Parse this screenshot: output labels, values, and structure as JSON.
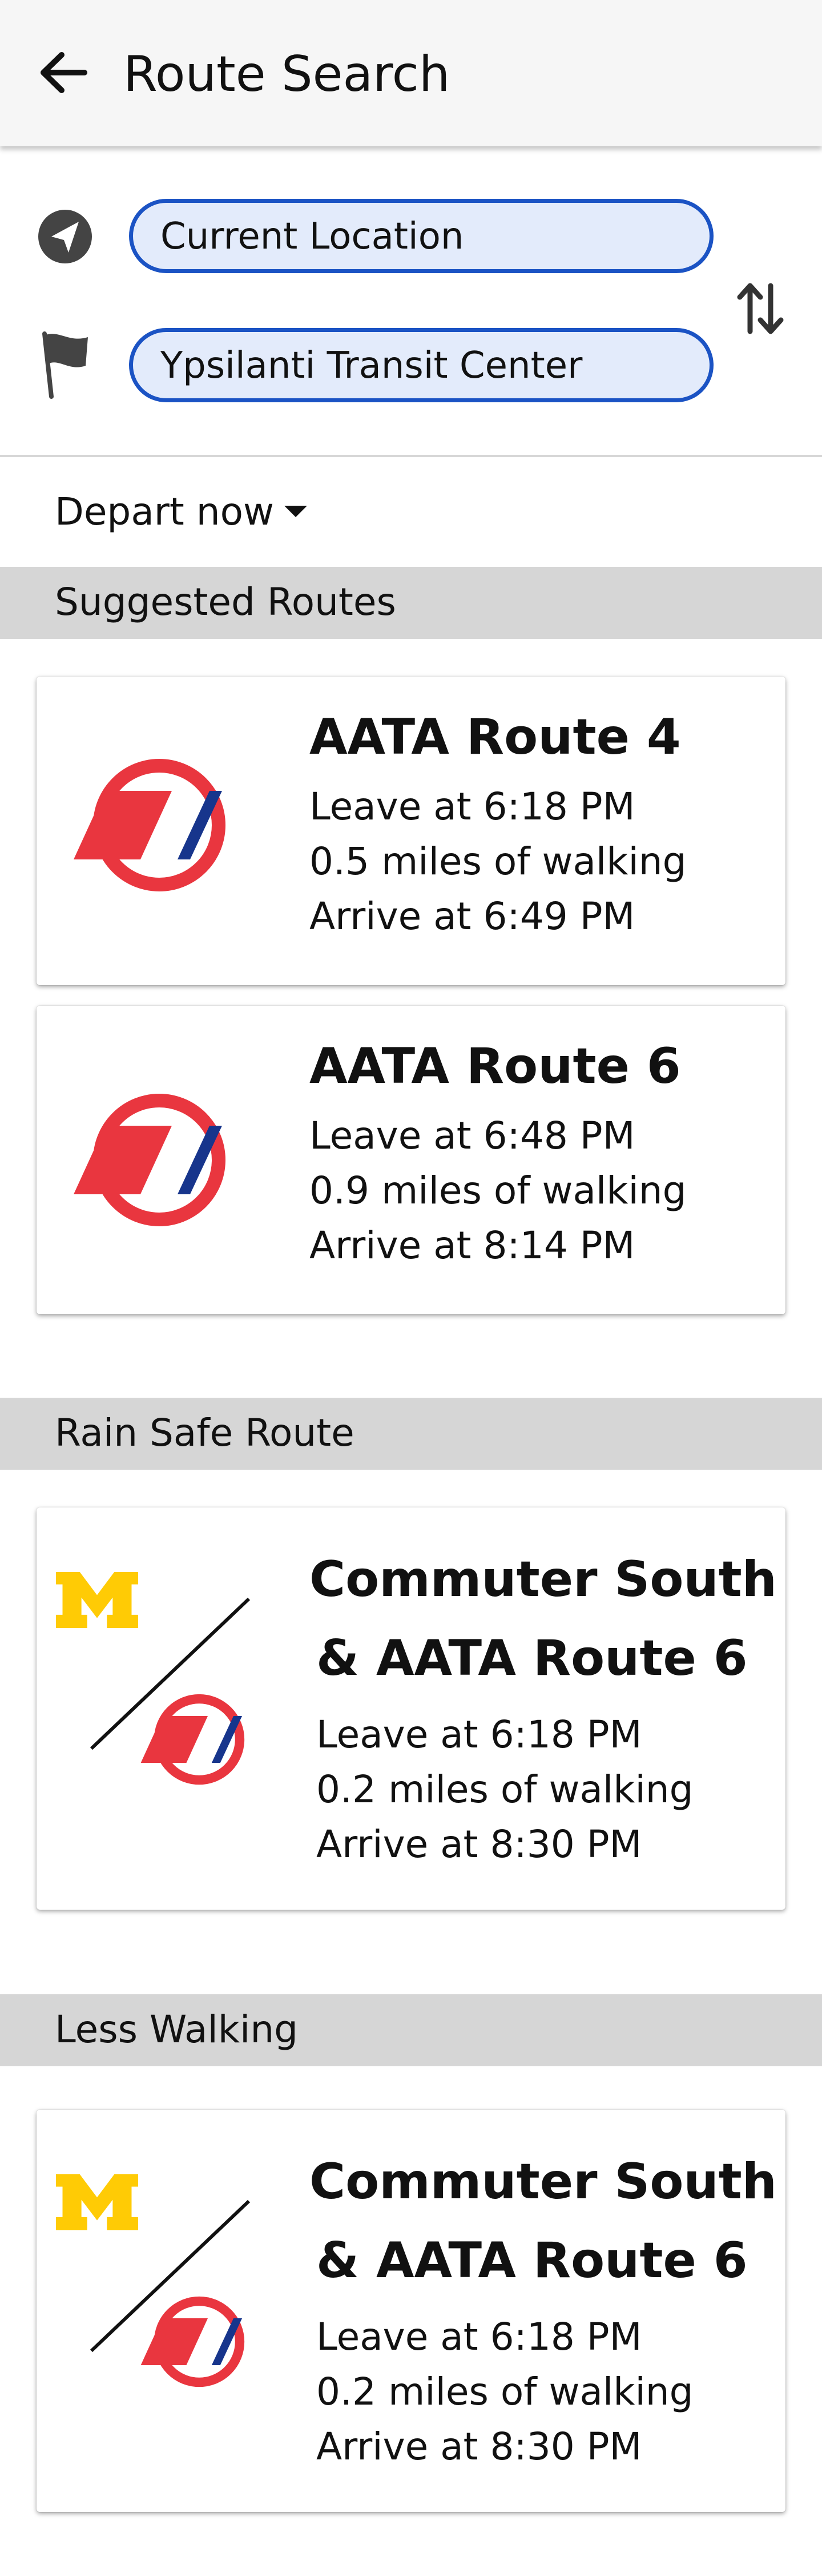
{
  "header": {
    "title": "Route Search"
  },
  "origin": {
    "value": "Current Location",
    "icon": "navigation-arrow-icon"
  },
  "destination": {
    "value": "Ypsilanti Transit Center",
    "icon": "flag-icon"
  },
  "depart": {
    "label": "Depart now"
  },
  "colors": {
    "field_border": "#1b53c4",
    "field_fill": "#e3ebfb",
    "aata_red": "#e9363f",
    "aata_blue": "#17358c",
    "um_maize": "#ffcb05"
  },
  "sections": [
    {
      "title": "Suggested Routes",
      "cards": [
        {
          "title": "AATA Route 4",
          "leave": "Leave at 6:18 PM",
          "walk": "0.5 miles of walking",
          "arrive": "Arrive at 6:49 PM",
          "logo": "aata-logo-icon"
        },
        {
          "title": "AATA Route 6",
          "leave": "Leave at 6:48 PM",
          "walk": "0.9 miles of walking",
          "arrive": "Arrive at 8:14 PM",
          "logo": "aata-logo-icon"
        }
      ]
    },
    {
      "title": "Rain Safe Route",
      "cards": [
        {
          "title_line1": "Commuter South",
          "title_line2": "& AATA Route 6",
          "leave": "Leave at 6:18 PM",
          "walk": "0.2 miles of walking",
          "arrive": "Arrive at 8:30 PM",
          "logo": "um-and-aata-logo-icon"
        }
      ]
    },
    {
      "title": "Less Walking",
      "cards": [
        {
          "title_line1": "Commuter South",
          "title_line2": "& AATA Route 6",
          "leave": "Leave at 6:18 PM",
          "walk": "0.2 miles of walking",
          "arrive": "Arrive at 8:30 PM",
          "logo": "um-and-aata-logo-icon"
        }
      ]
    }
  ]
}
